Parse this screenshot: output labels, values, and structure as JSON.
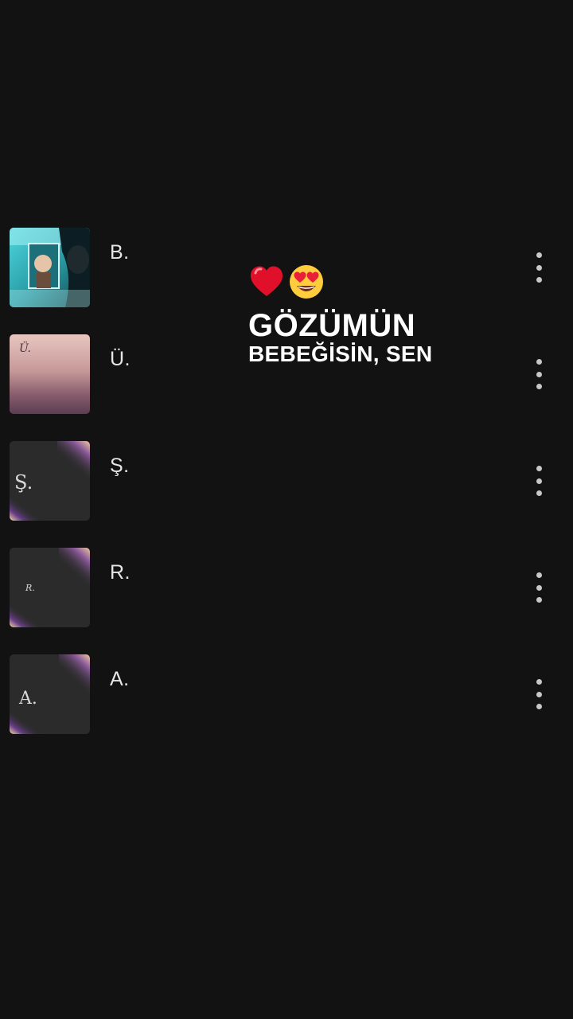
{
  "contacts": [
    {
      "name": "B.",
      "thumb": "photo-man-mirror"
    },
    {
      "name": "Ü.",
      "thumb": "letter-u-pink-sky",
      "thumb_text": "Ü."
    },
    {
      "name": "Ş.",
      "thumb": "letter-s-dark-light-leak",
      "thumb_text": "Ş."
    },
    {
      "name": "R.",
      "thumb": "letter-r-dark-light-leak",
      "thumb_text": "R."
    },
    {
      "name": "A.",
      "thumb": "letter-a-dark-light-leak",
      "thumb_text": "A."
    }
  ],
  "overlay": {
    "emojis": [
      "red-heart-icon",
      "heart-eyes-face-icon"
    ],
    "line1": "GÖZÜMÜN",
    "line2": "BEBEĞİSİN, SEN"
  },
  "colors": {
    "background": "#121212",
    "text": "#e6e6e6",
    "overlay_text": "#ffffff",
    "menu_dots": "#c8c8c8"
  }
}
